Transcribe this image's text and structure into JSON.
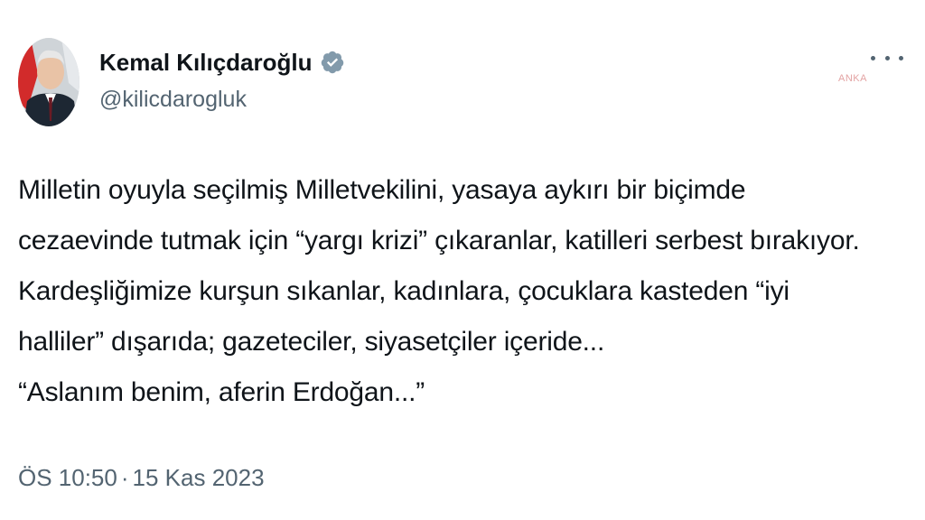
{
  "author": {
    "name": "Kemal Kılıçdaroğlu",
    "handle": "@kilicdarogluk"
  },
  "watermark": "ANKA",
  "tweet": {
    "lines": [
      "Milletin oyuyla seçilmiş Milletvekilini, yasaya aykırı bir biçimde",
      "cezaevinde tutmak için “yargı krizi” çıkaranlar, katilleri serbest bırakıyor.",
      "Kardeşliğimize kurşun sıkanlar, kadınlara, çocuklara kasteden “iyi",
      "halliler” dışarıda; gazeteciler, siyasetçiler içeride...",
      "“Aslanım benim, aferin Erdoğan...”"
    ]
  },
  "meta": {
    "time": "ÖS 10:50",
    "separator": "·",
    "date": "15 Kas 2023"
  },
  "colors": {
    "text": "#0f1419",
    "secondary": "#536471",
    "verified_badge": "#829aab"
  },
  "icons": {
    "verified": "verified-badge-icon",
    "more": "more-options-icon"
  }
}
